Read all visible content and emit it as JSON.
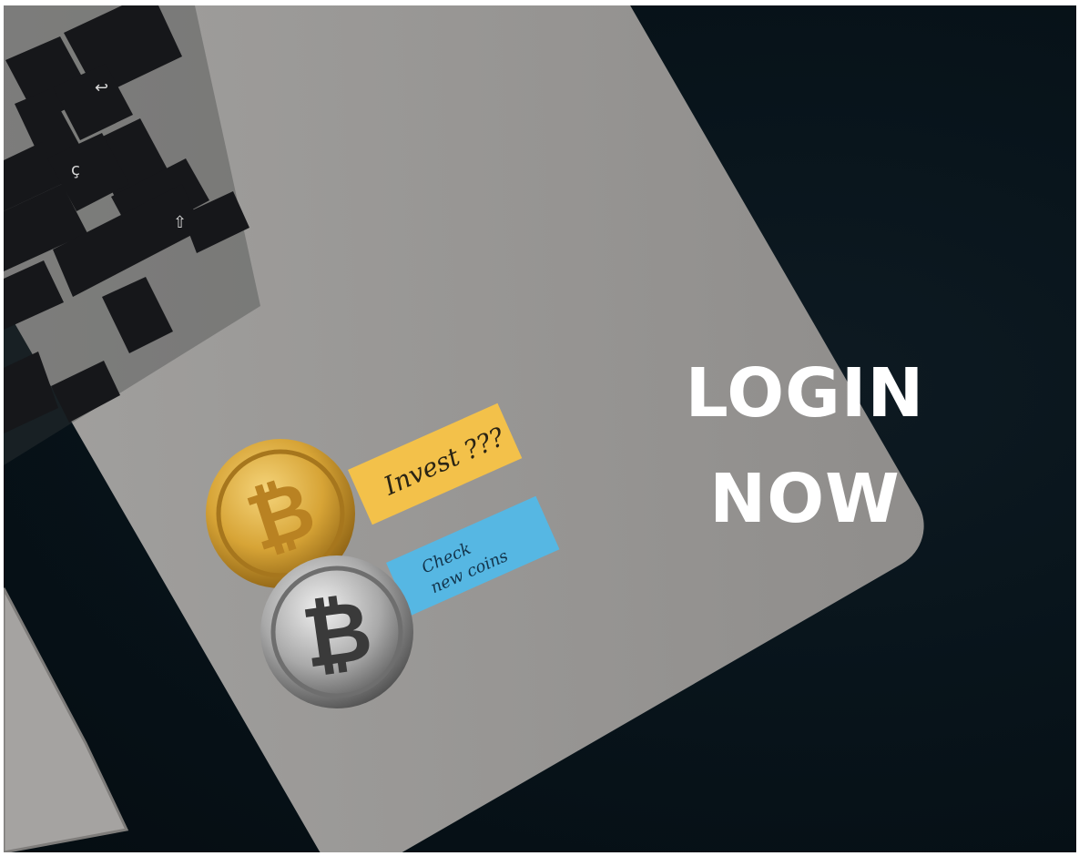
{
  "hero": {
    "cta_line1": "LOGIN",
    "cta_line2": "NOW"
  },
  "sticky_notes": {
    "yellow_note": "Invest ???",
    "blue_note_line1": "Check",
    "blue_note_line2": "new coins"
  },
  "colors": {
    "background": "#07121a",
    "laptop": "#9c9a98",
    "keys": "#17181a",
    "gold_coin": "#d9a83a",
    "silver_coin": "#b8b8b8",
    "yellow_note": "#f3c14a",
    "blue_note": "#56b7e3",
    "cta_text": "#ffffff"
  },
  "icons": [
    "bitcoin-gold-coin-icon",
    "bitcoin-silver-coin-icon"
  ]
}
